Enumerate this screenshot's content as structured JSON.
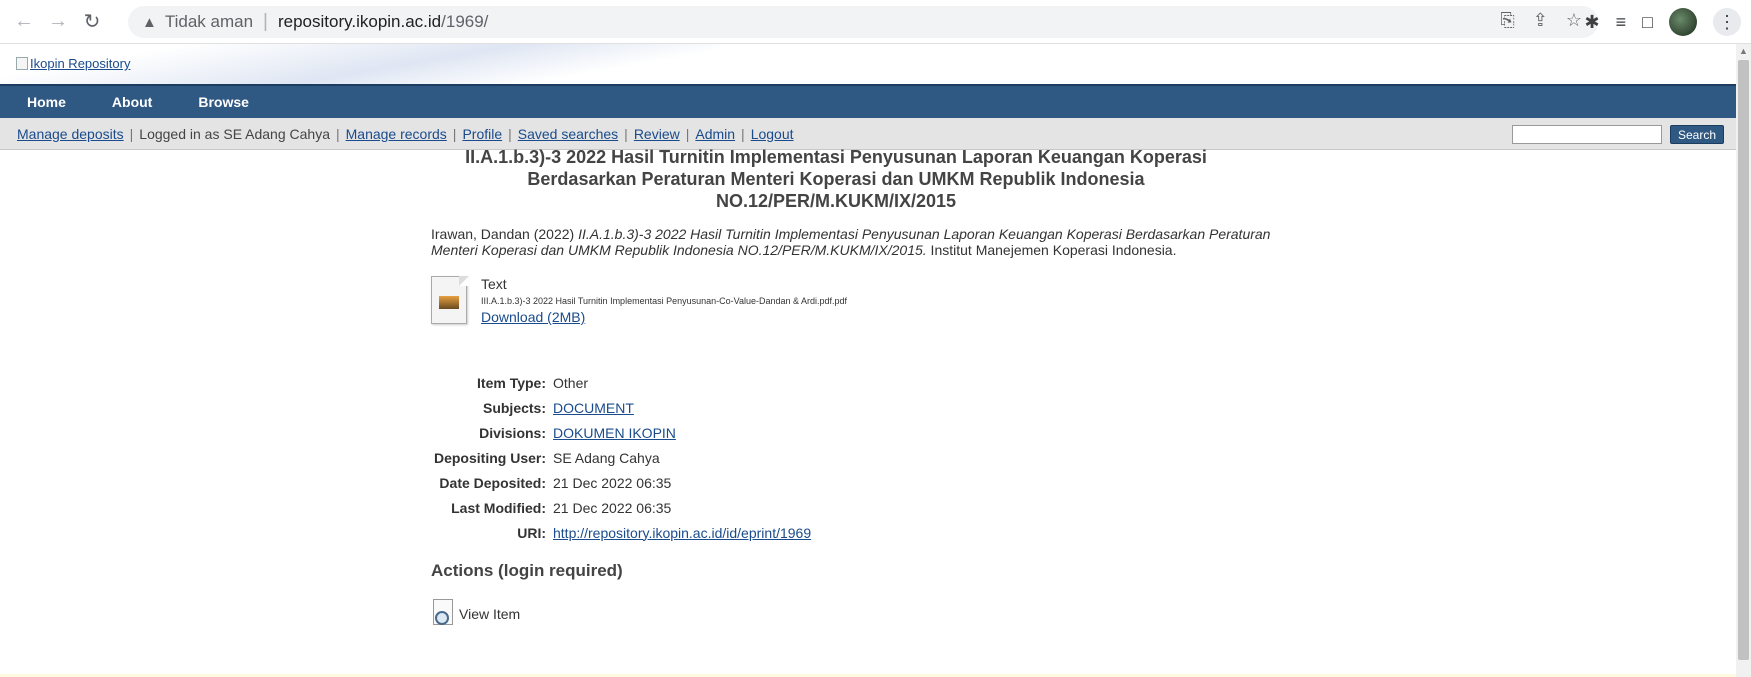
{
  "browser": {
    "warning_label": "Tidak aman",
    "url_host": "repository.ikopin.ac.id",
    "url_path": "/1969/"
  },
  "site": {
    "logo_alt": "Ikopin Repository",
    "menu": [
      "Home",
      "About",
      "Browse"
    ],
    "toolbar": {
      "manage_deposits": "Manage deposits",
      "logged_in": "Logged in as SE Adang Cahya",
      "links": [
        "Manage records",
        "Profile",
        "Saved searches",
        "Review",
        "Admin",
        "Logout"
      ]
    },
    "search_button": "Search",
    "search_value": ""
  },
  "eprint": {
    "title_line1": "II.A.1.b.3)-3 2022 Hasil Turnitin Implementasi Penyusunan Laporan Keuangan Koperasi",
    "title_line2": "Berdasarkan Peraturan Menteri Koperasi dan UMKM Republik Indonesia",
    "title_line3": "NO.12/PER/M.KUKM/IX/2015",
    "citation_author": "Irawan, Dandan (2022) ",
    "citation_title": "II.A.1.b.3)-3 2022 Hasil Turnitin Implementasi Penyusunan Laporan Keuangan Koperasi Berdasarkan Peraturan Menteri Koperasi dan UMKM Republik Indonesia NO.12/PER/M.KUKM/IX/2015.",
    "citation_publisher": " Institut Manejemen Koperasi Indonesia.",
    "document": {
      "type": "Text",
      "filename": "III.A.1.b.3)-3 2022 Hasil Turnitin Implementasi Penyusunan-Co-Value-Dandan & Ardi.pdf.pdf",
      "download_label": "Download (2MB)"
    },
    "metadata": [
      {
        "label": "Item Type:",
        "value": "Other",
        "link": false
      },
      {
        "label": "Subjects:",
        "value": "DOCUMENT",
        "link": true
      },
      {
        "label": "Divisions:",
        "value": "DOKUMEN IKOPIN",
        "link": true
      },
      {
        "label": "Depositing User:",
        "value": "SE Adang Cahya",
        "link": false
      },
      {
        "label": "Date Deposited:",
        "value": "21 Dec 2022 06:35",
        "link": false
      },
      {
        "label": "Last Modified:",
        "value": "21 Dec 2022 06:35",
        "link": false
      },
      {
        "label": "URI:",
        "value": "http://repository.ikopin.ac.id/id/eprint/1969",
        "link": true
      }
    ],
    "actions_title": "Actions (login required)",
    "action_view": "View Item"
  }
}
